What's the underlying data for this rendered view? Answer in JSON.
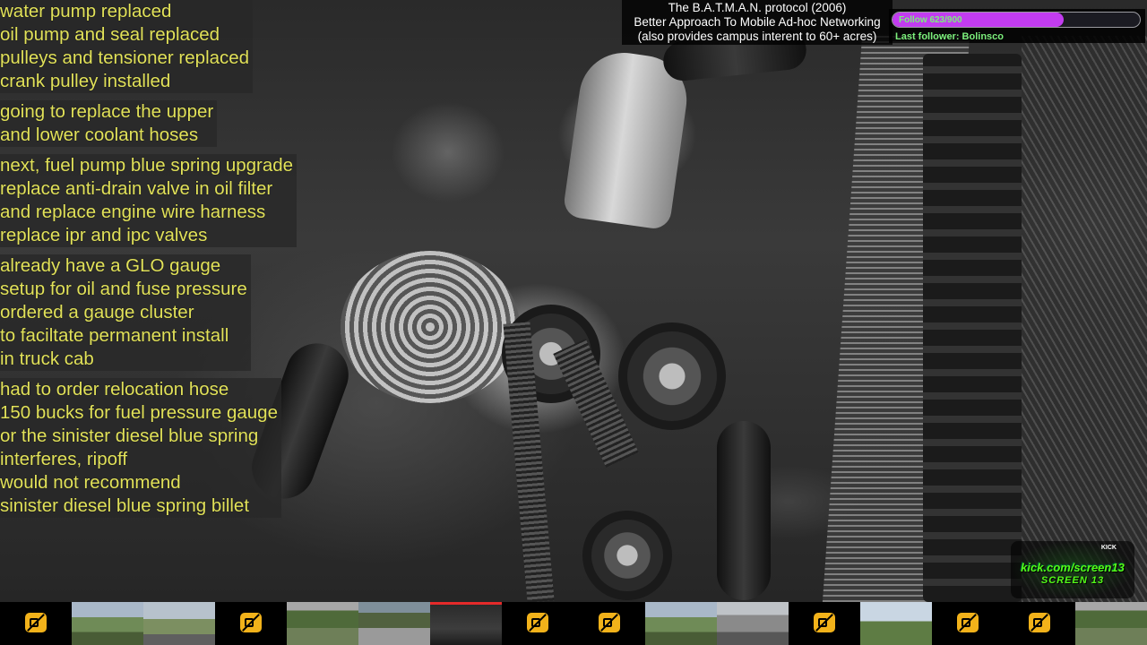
{
  "notes": [
    [
      "water pump replaced",
      "oil pump and seal replaced",
      "pulleys and tensioner replaced",
      "crank pulley installed"
    ],
    [
      "going to replace the upper",
      "and lower coolant hoses"
    ],
    [
      "next, fuel pump blue spring upgrade",
      "replace anti-drain valve in oil filter",
      "and replace engine wire harness",
      "replace ipr and ipc valves"
    ],
    [
      "already have a GLO gauge",
      "setup for oil and fuse pressure",
      "ordered a gauge cluster",
      "to faciltate permanent install",
      "in truck cab"
    ],
    [
      "had to order relocation hose",
      "150 bucks for fuel pressure gauge",
      "or the sinister diesel blue spring",
      "interferes, ripoff",
      "would not recommend",
      "sinister diesel blue spring billet"
    ]
  ],
  "protocol": {
    "line1": "The B.A.T.M.A.N. protocol (2006)",
    "line2": "Better Approach To Mobile Ad-hoc Networking",
    "line3": "(also provides campus interent to 60+ acres)"
  },
  "follow": {
    "text": "Follow 623/900",
    "current": 623,
    "goal": 900,
    "last_follower": "Last follower: Bolinsco",
    "bar_color": "#c23cf0",
    "text_color": "#7cf07c"
  },
  "kick_logo": {
    "small": "KICK",
    "url": "kick.com/screen13",
    "screen": "SCREEN 13",
    "color": "#53fc18"
  },
  "camera_strip": [
    {
      "state": "offline",
      "icon": "camera-off-icon"
    },
    {
      "state": "feed",
      "feed": "field"
    },
    {
      "state": "feed",
      "feed": "road"
    },
    {
      "state": "offline",
      "icon": "camera-off-icon"
    },
    {
      "state": "feed",
      "feed": "trees"
    },
    {
      "state": "feed",
      "feed": "cars"
    },
    {
      "state": "feed",
      "feed": "dark",
      "active": true
    },
    {
      "state": "offline",
      "icon": "camera-off-icon"
    },
    {
      "state": "offline",
      "icon": "camera-off-icon"
    },
    {
      "state": "feed",
      "feed": "field"
    },
    {
      "state": "feed",
      "feed": "gray"
    },
    {
      "state": "offline",
      "icon": "camera-off-icon"
    },
    {
      "state": "feed",
      "feed": "sky"
    },
    {
      "state": "offline",
      "icon": "camera-off-icon"
    },
    {
      "state": "offline",
      "icon": "camera-off-icon"
    },
    {
      "state": "feed",
      "feed": "trees"
    }
  ]
}
